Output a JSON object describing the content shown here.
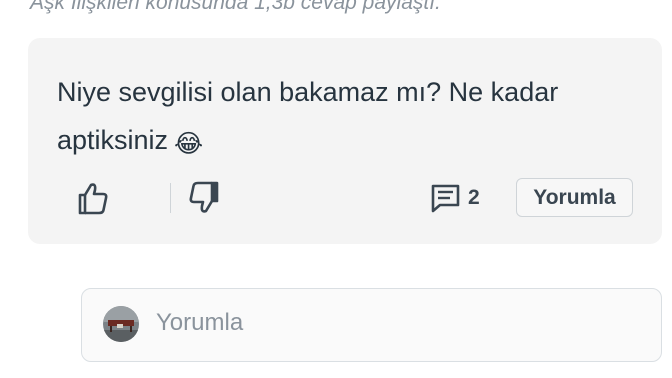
{
  "answer": {
    "meta": "Aşk İlişkileri konusunda 1,3b cevap paylaştı.",
    "text": "Niye sevgilisi olan bakamaz mı? Ne kadar aptiksiniz",
    "emoji": "😂",
    "comment_count": "2",
    "reply_label": "Yorumla",
    "icons": {
      "like": "thumbs-up-icon",
      "dislike": "thumbs-down-icon",
      "comments": "comment-icon"
    }
  },
  "comment_input": {
    "placeholder": "Yorumla",
    "avatar": "user-avatar"
  },
  "colors": {
    "card_background": "#f4f4f4",
    "text": "#27343f",
    "muted": "#8a939c",
    "icon": "#3a4651",
    "border": "#cfd4d8"
  }
}
